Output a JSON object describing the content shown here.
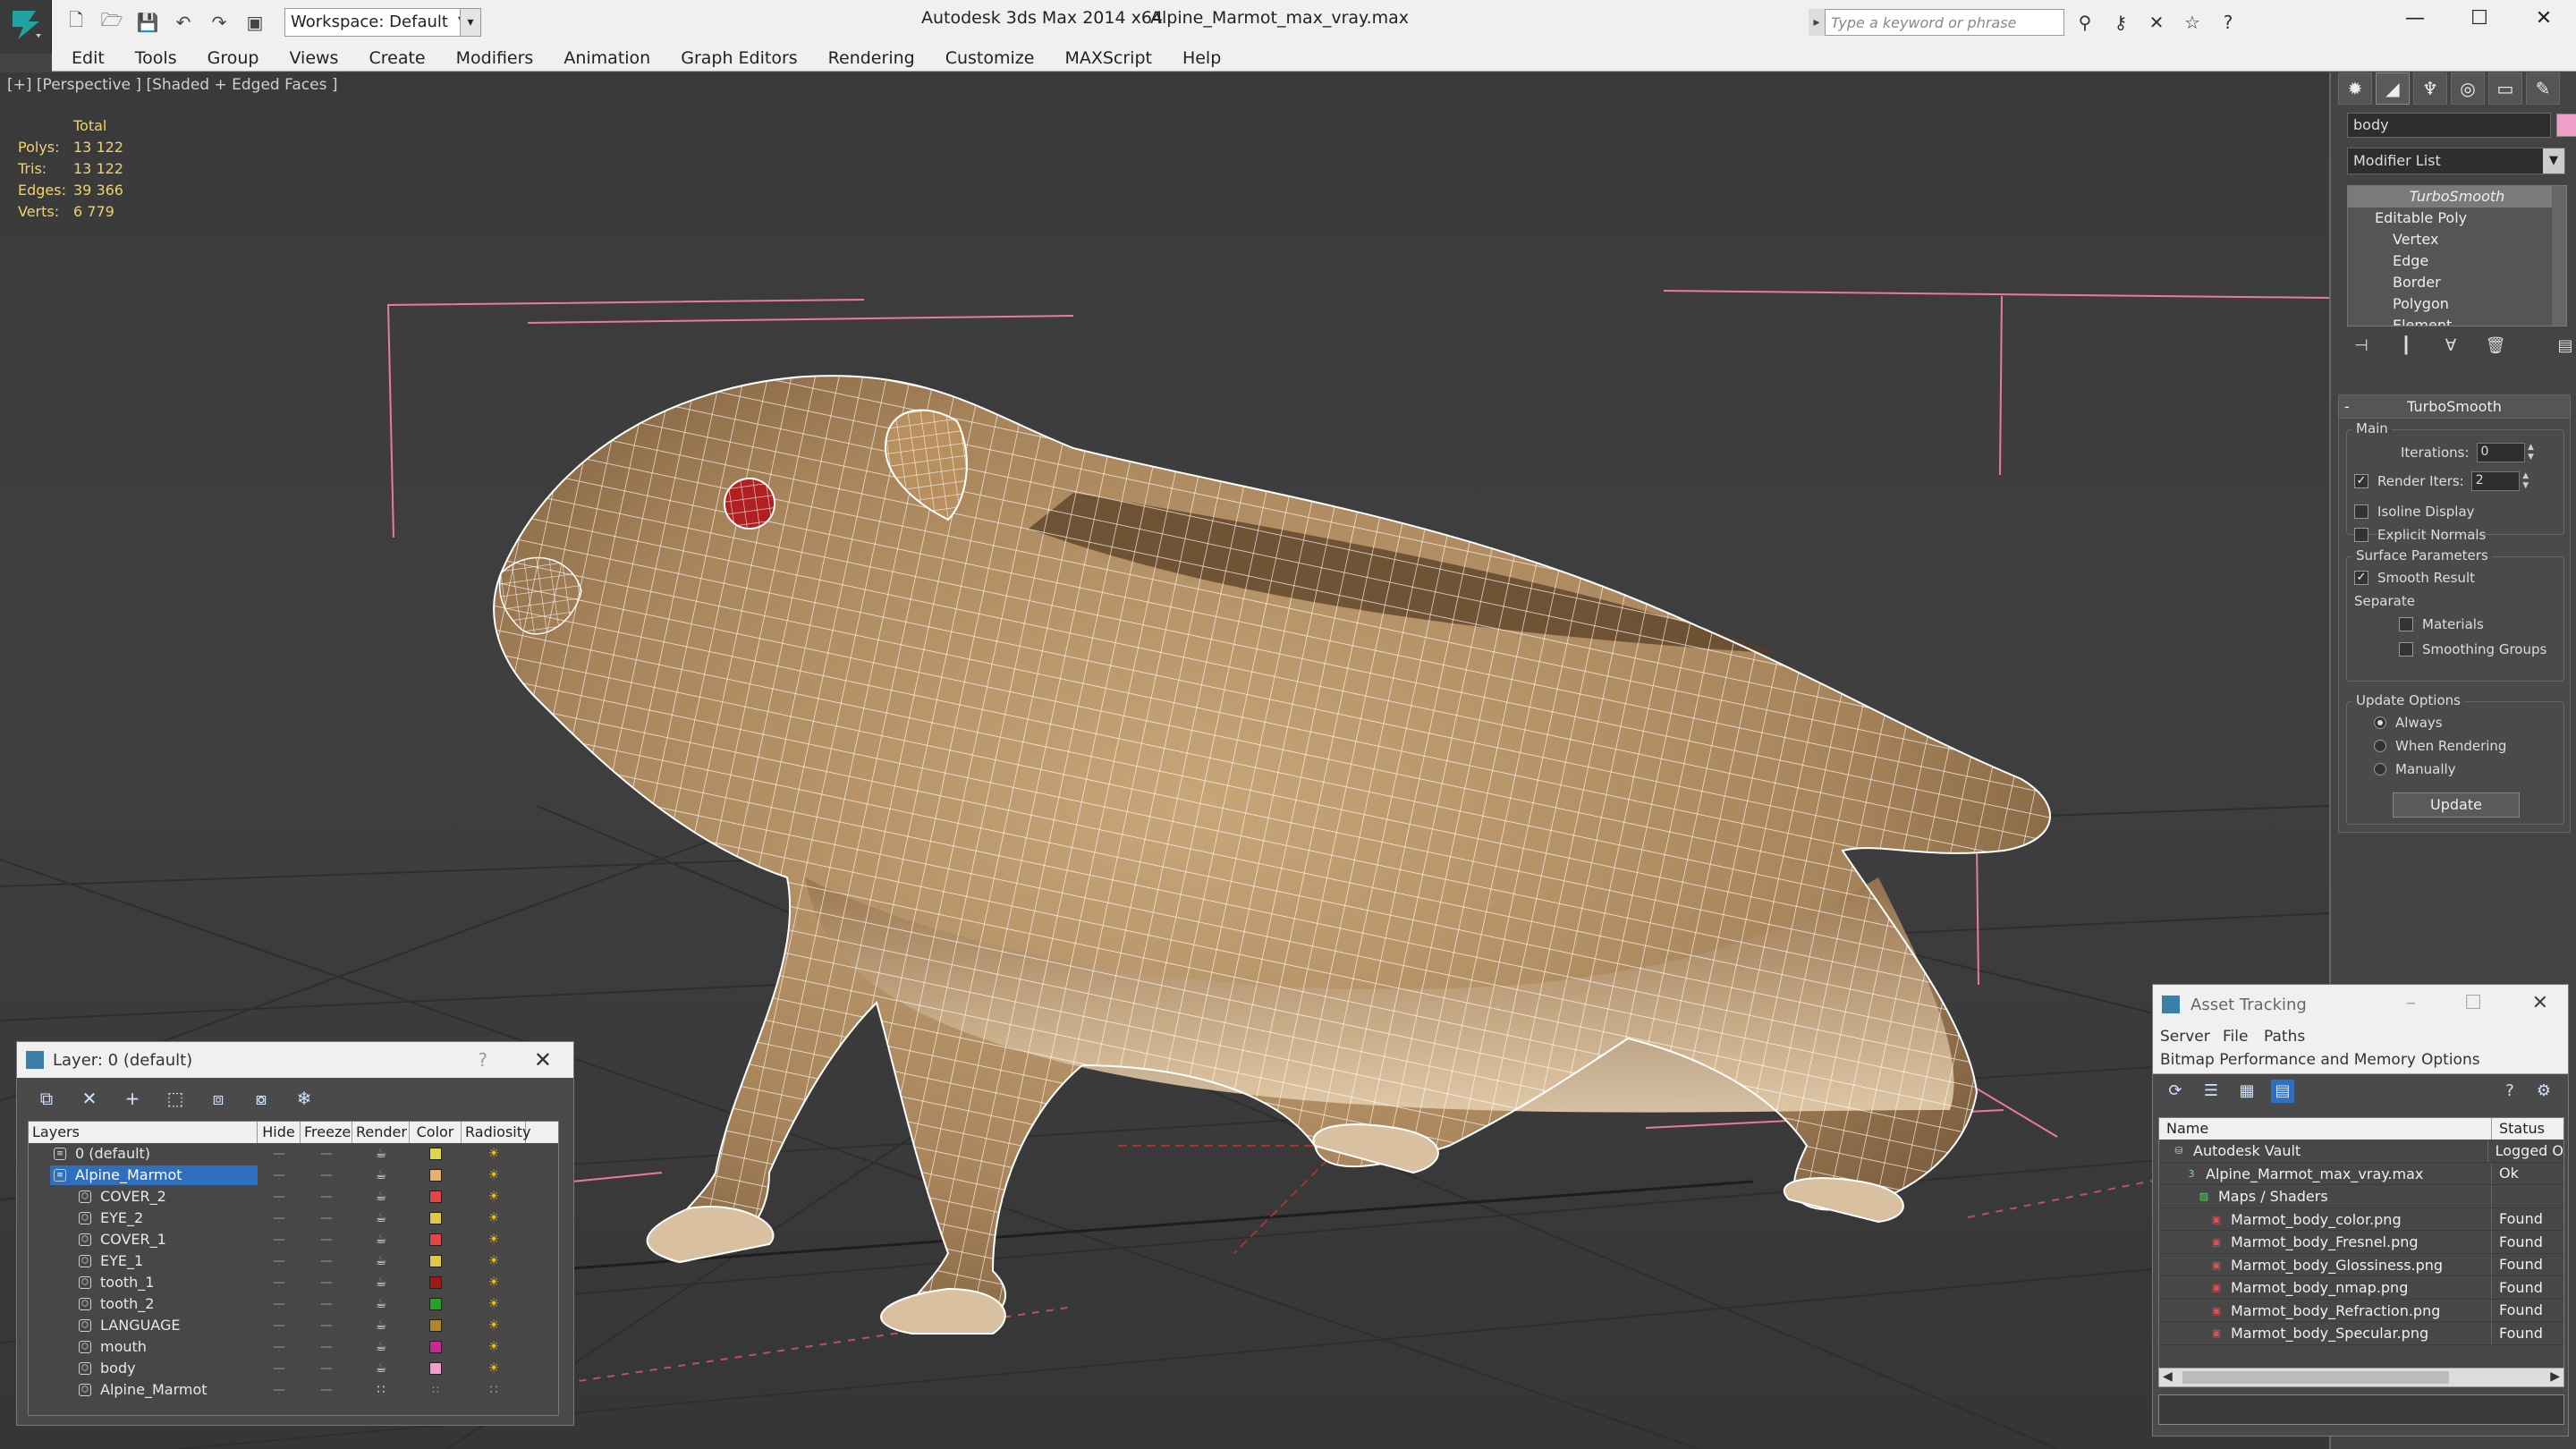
{
  "titlebar": {
    "app_title": "Autodesk 3ds Max  2014 x64",
    "file_title": "Alpine_Marmot_max_vray.max",
    "workspace": "Workspace: Default",
    "search_placeholder": "Type a keyword or phrase",
    "minimize": "—",
    "maximize": "☐",
    "close": "✕"
  },
  "menu": [
    "Edit",
    "Tools",
    "Group",
    "Views",
    "Create",
    "Modifiers",
    "Animation",
    "Graph Editors",
    "Rendering",
    "Customize",
    "MAXScript",
    "Help"
  ],
  "viewport": {
    "label": "[+] [Perspective ] [Shaded + Edged Faces ]",
    "stats": {
      "header": "Total",
      "rows": [
        {
          "label": "Polys:",
          "value": "13 122"
        },
        {
          "label": "Tris:",
          "value": "13 122"
        },
        {
          "label": "Edges:",
          "value": "39 366"
        },
        {
          "label": "Verts:",
          "value": "6 779"
        }
      ]
    }
  },
  "command_panel": {
    "object_name": "body",
    "object_color": "#f0a0c8",
    "modifier_list": "Modifier List",
    "stack": {
      "top": "TurboSmooth",
      "base": "Editable Poly",
      "subs": [
        "Vertex",
        "Edge",
        "Border",
        "Polygon",
        "Element"
      ]
    },
    "turbosmooth": {
      "title": "TurboSmooth",
      "main_group": "Main",
      "iterations_label": "Iterations:",
      "iterations_value": "0",
      "render_iters_label": "Render Iters:",
      "render_iters_value": "2",
      "render_iters_checked": true,
      "isoline_label": "Isoline Display",
      "explicit_label": "Explicit Normals",
      "surface_group": "Surface Parameters",
      "smooth_result_label": "Smooth Result",
      "smooth_result_checked": true,
      "separate_label": "Separate",
      "materials_label": "Materials",
      "smoothing_groups_label": "Smoothing Groups",
      "update_group": "Update Options",
      "always_label": "Always",
      "when_rendering_label": "When Rendering",
      "manually_label": "Manually",
      "update_button": "Update"
    }
  },
  "layer_panel": {
    "title": "Layer: 0 (default)",
    "help": "?",
    "close": "✕",
    "columns": [
      "Layers",
      "Hide",
      "Freeze",
      "Render",
      "Color",
      "Radiosity"
    ],
    "layers": [
      {
        "name": "0 (default)",
        "level": 0,
        "color": "#d8d84a",
        "selected": false,
        "current": true
      },
      {
        "name": "Alpine_Marmot",
        "level": 0,
        "color": "#e8b070",
        "selected": true,
        "current": false
      },
      {
        "name": "COVER_2",
        "level": 1,
        "color": "#e04848",
        "selected": false
      },
      {
        "name": "EYE_2",
        "level": 1,
        "color": "#e0c848",
        "selected": false
      },
      {
        "name": "COVER_1",
        "level": 1,
        "color": "#e04848",
        "selected": false
      },
      {
        "name": "EYE_1",
        "level": 1,
        "color": "#e0c848",
        "selected": false
      },
      {
        "name": "tooth_1",
        "level": 1,
        "color": "#a01818",
        "selected": false
      },
      {
        "name": "tooth_2",
        "level": 1,
        "color": "#28a028",
        "selected": false
      },
      {
        "name": "LANGUAGE",
        "level": 1,
        "color": "#b08828",
        "selected": false
      },
      {
        "name": "mouth",
        "level": 1,
        "color": "#c82890",
        "selected": false
      },
      {
        "name": "body",
        "level": 1,
        "color": "#f0a0c8",
        "selected": false
      },
      {
        "name": "Alpine_Marmot",
        "level": 1,
        "color": "",
        "selected": false
      }
    ]
  },
  "asset_panel": {
    "title": "Asset Tracking",
    "menu_row1": [
      "Server",
      "File",
      "Paths"
    ],
    "menu_row2": [
      "Bitmap Performance and Memory",
      "Options"
    ],
    "columns": [
      "Name",
      "Status"
    ],
    "rows": [
      {
        "name": "Autodesk Vault",
        "status": "Logged O",
        "level": 0,
        "icon": "vault-icon"
      },
      {
        "name": "Alpine_Marmot_max_vray.max",
        "status": "Ok",
        "level": 1,
        "icon": "max-file-icon"
      },
      {
        "name": "Maps / Shaders",
        "status": "",
        "level": 2,
        "icon": "maps-icon"
      },
      {
        "name": "Marmot_body_color.png",
        "status": "Found",
        "level": 3,
        "icon": "png-icon"
      },
      {
        "name": "Marmot_body_Fresnel.png",
        "status": "Found",
        "level": 3,
        "icon": "png-icon"
      },
      {
        "name": "Marmot_body_Glossiness.png",
        "status": "Found",
        "level": 3,
        "icon": "png-icon"
      },
      {
        "name": "Marmot_body_nmap.png",
        "status": "Found",
        "level": 3,
        "icon": "png-icon"
      },
      {
        "name": "Marmot_body_Refraction.png",
        "status": "Found",
        "level": 3,
        "icon": "png-icon"
      },
      {
        "name": "Marmot_body_Specular.png",
        "status": "Found",
        "level": 3,
        "icon": "png-icon"
      }
    ]
  }
}
